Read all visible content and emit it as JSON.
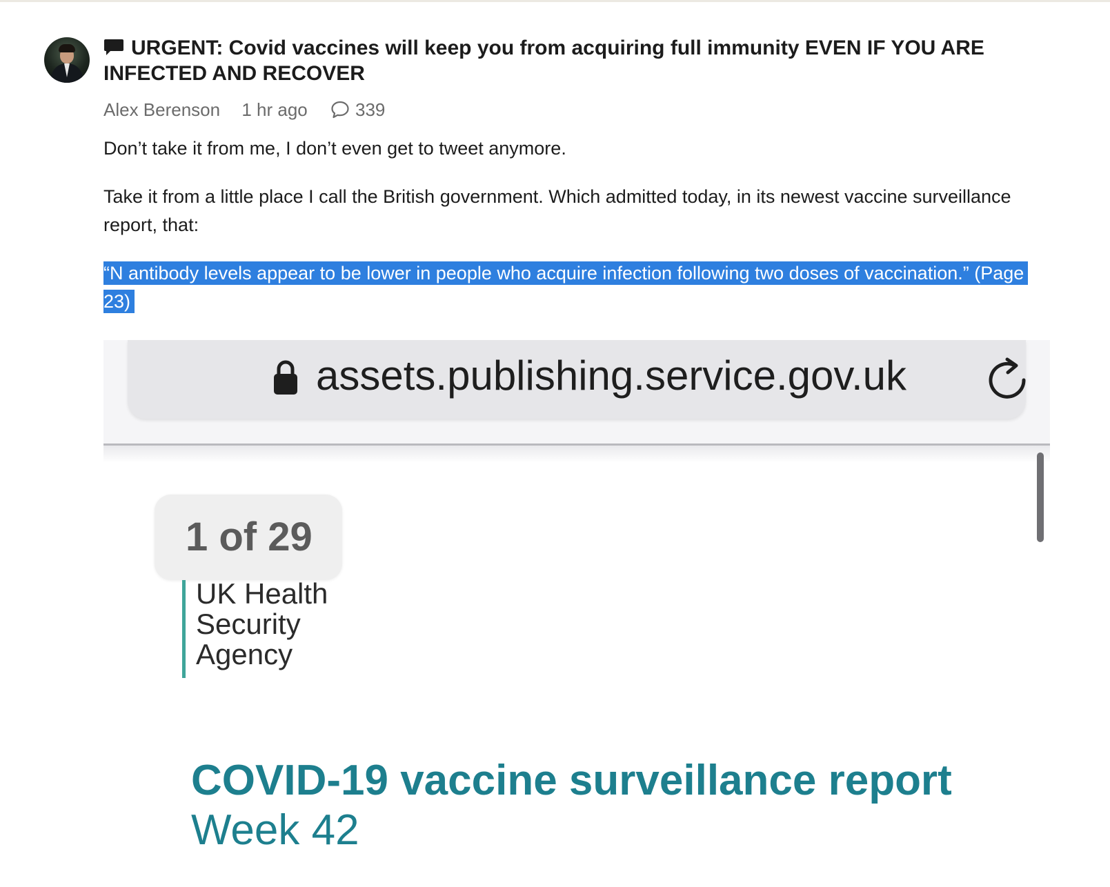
{
  "post": {
    "title": "URGENT: Covid vaccines will keep you from acquiring full immunity EVEN IF YOU ARE INFECTED AND RECOVER",
    "author": "Alex Berenson",
    "time": "1 hr ago",
    "comment_count": "339",
    "paragraphs": [
      "Don’t take it from me, I don’t even get to tweet anymore.",
      "Take it from a little place I call the British government. Which admitted today, in its newest vaccine surveillance report, that:"
    ],
    "highlighted_quote": "“N antibody levels appear to be lower in people who acquire infection following two doses of vaccination.” (Page 23)"
  },
  "embedded_screenshot": {
    "url": "assets.publishing.service.gov.uk",
    "page_counter": "1 of 29",
    "agency_lines": [
      "UK Health",
      "Security",
      "Agency"
    ],
    "report_title": "COVID-19 vaccine surveillance report",
    "report_subtitle": "Week 42"
  },
  "icons": {
    "post_type": "chat-bubble-icon",
    "comments": "comment-icon",
    "url_lock": "lock-icon",
    "reload": "reload-icon"
  },
  "colors": {
    "selection_highlight": "#2e7fdf",
    "report_teal": "#1d7f8e",
    "agency_bar": "#3fa59a"
  }
}
